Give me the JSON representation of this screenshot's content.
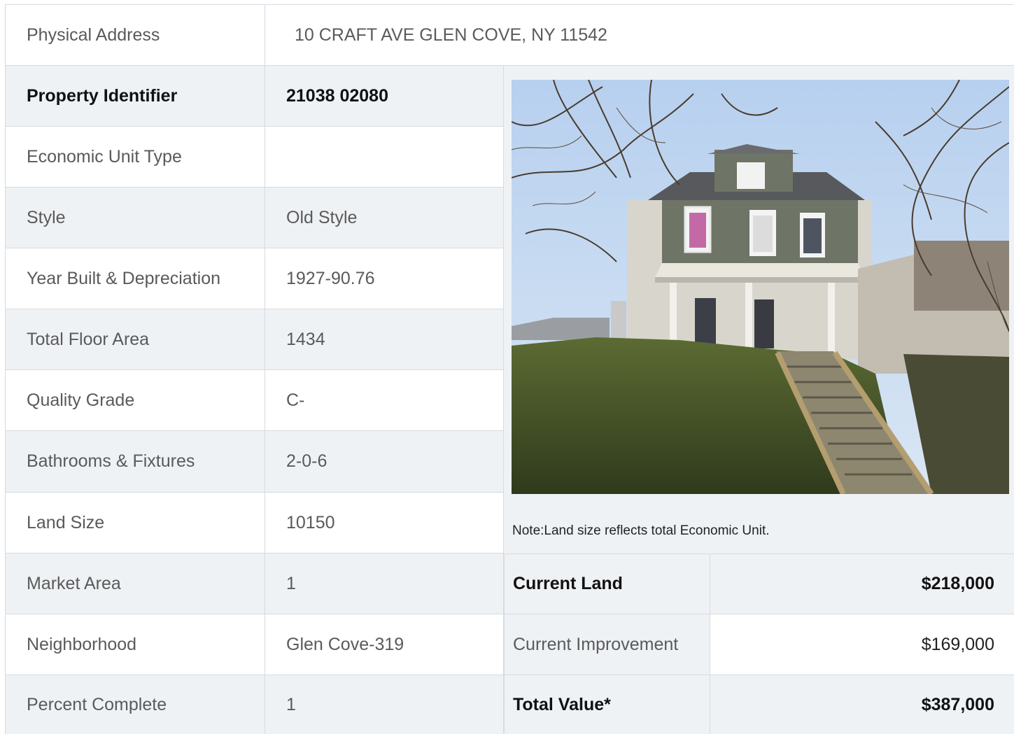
{
  "address": {
    "label": "Physical Address",
    "value": "10  CRAFT AVE  GLEN COVE, NY  11542"
  },
  "details": [
    {
      "label": "Property Identifier",
      "value": "21038  02080"
    },
    {
      "label": "Economic Unit Type",
      "value": ""
    },
    {
      "label": "Style",
      "value": "Old Style"
    },
    {
      "label": "Year Built & Depreciation",
      "value": "1927-90.76"
    },
    {
      "label": "Total Floor Area",
      "value": "1434"
    },
    {
      "label": "Quality Grade",
      "value": "C-"
    },
    {
      "label": "Bathrooms & Fixtures",
      "value": "2-0-6"
    },
    {
      "label": "Land Size",
      "value": "10150"
    },
    {
      "label": "Market Area",
      "value": "1"
    },
    {
      "label": "Neighborhood",
      "value": "Glen Cove-319"
    },
    {
      "label": "Percent Complete",
      "value": "1"
    }
  ],
  "note": "Note:Land size reflects total Economic Unit.",
  "values": [
    {
      "label": "Current Land",
      "value": "$218,000"
    },
    {
      "label": "Current Improvement",
      "value": "$169,000"
    },
    {
      "label": "Total Value*",
      "value": "$387,000"
    }
  ],
  "colors": {
    "row_alt": "#eff2f5",
    "border": "#d6dbe0",
    "sky": "#a9c6e8",
    "house_siding": "#6f7566",
    "grass": "#4d5a2c"
  }
}
